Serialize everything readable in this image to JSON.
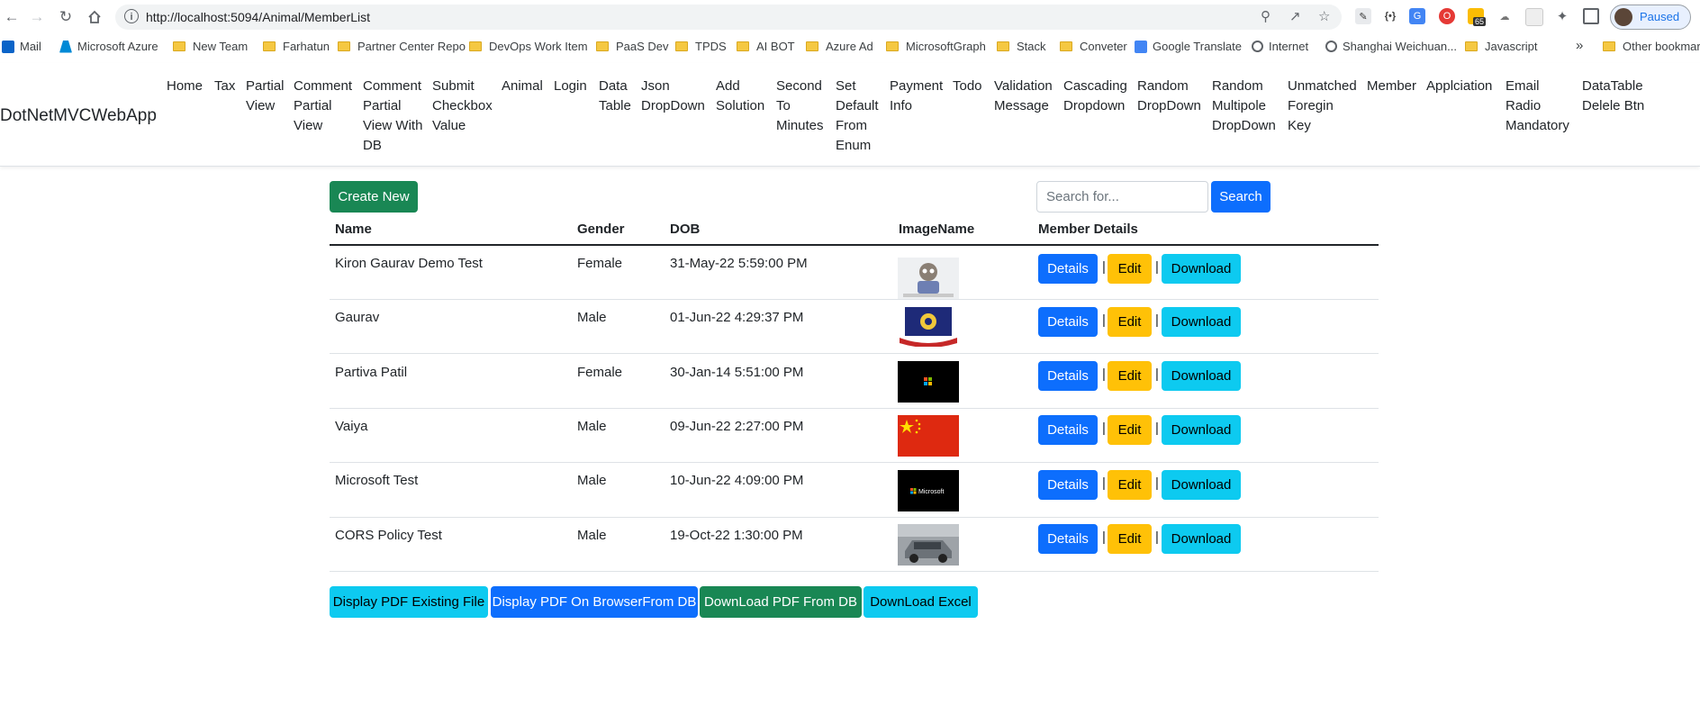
{
  "browser": {
    "url": "http://localhost:5094/Animal/MemberList",
    "profile_status": "Paused",
    "extension_badge": "65",
    "bookmarks": [
      "Mail",
      "Microsoft Azure",
      "New Team",
      "Farhatun",
      "Partner Center Repo",
      "DevOps Work Item",
      "PaaS Dev",
      "TPDS",
      "AI BOT",
      "Azure Ad",
      "MicrosoftGraph",
      "Stack",
      "Conveter",
      "Google Translate",
      "Internet",
      "Shanghai Weichuan...",
      "Javascript"
    ],
    "more_bookmarks": "»",
    "other_bookmarks": "Other bookmarks"
  },
  "navbar": {
    "brand": "DotNetMVCWebApp",
    "links": [
      {
        "label": "Home"
      },
      {
        "label": "Tax"
      },
      {
        "label": "Partial View"
      },
      {
        "label": "Comment Partial View"
      },
      {
        "label": "Comment Partial View With DB"
      },
      {
        "label": "Submit Checkbox Value"
      },
      {
        "label": "Animal"
      },
      {
        "label": "Login"
      },
      {
        "label": "Data Table"
      },
      {
        "label": "Json DropDown"
      },
      {
        "label": "Add Solution"
      },
      {
        "label": "Second To Minutes"
      },
      {
        "label": "Set Default From Enum"
      },
      {
        "label": "Payment Info"
      },
      {
        "label": "Todo"
      },
      {
        "label": "Validation Message"
      },
      {
        "label": "Cascading Dropdown"
      },
      {
        "label": "Random DropDown"
      },
      {
        "label": "Random Multipole DropDown"
      },
      {
        "label": "Unmatched Foregin Key"
      },
      {
        "label": "Member"
      },
      {
        "label": "Applciation"
      },
      {
        "label": "Email Radio Mandatory"
      },
      {
        "label": "DataTable Delele Btn"
      }
    ]
  },
  "toolbar": {
    "create_label": "Create New",
    "search_placeholder": "Search for...",
    "search_label": "Search"
  },
  "table": {
    "headers": [
      "Name",
      "Gender",
      "DOB",
      "ImageName",
      "Member Details"
    ],
    "rows": [
      {
        "name": "Kiron Gaurav Demo Test",
        "gender": "Female",
        "dob": "31-May-22 5:59:00 PM",
        "image": "cartoon-avatar"
      },
      {
        "name": "Gaurav",
        "gender": "Male",
        "dob": "01-Jun-22 4:29:37 PM",
        "image": "school-crest"
      },
      {
        "name": "Partiva Patil",
        "gender": "Female",
        "dob": "30-Jan-14 5:51:00 PM",
        "image": "windows-logo"
      },
      {
        "name": "Vaiya",
        "gender": "Male",
        "dob": "09-Jun-22 2:27:00 PM",
        "image": "china-flag"
      },
      {
        "name": "Microsoft Test",
        "gender": "Male",
        "dob": "10-Jun-22 4:09:00 PM",
        "image": "microsoft-logo"
      },
      {
        "name": "CORS Policy Test",
        "gender": "Male",
        "dob": "19-Oct-22 1:30:00 PM",
        "image": "car-photo"
      }
    ],
    "details_label": "Details",
    "edit_label": "Edit",
    "download_label": "Download",
    "separator": "|",
    "microsoft_thumb_text": "Microsoft"
  },
  "footer_buttons": {
    "display_pdf_existing": "Display PDF Existing File",
    "display_pdf_browser": "Display PDF On BrowserFrom DB",
    "download_pdf_db": "DownLoad PDF From DB",
    "download_excel": "DownLoad Excel"
  },
  "colors": {
    "primary": "#0d6efd",
    "success": "#198754",
    "warning": "#ffc107",
    "info": "#0dcaf0"
  }
}
